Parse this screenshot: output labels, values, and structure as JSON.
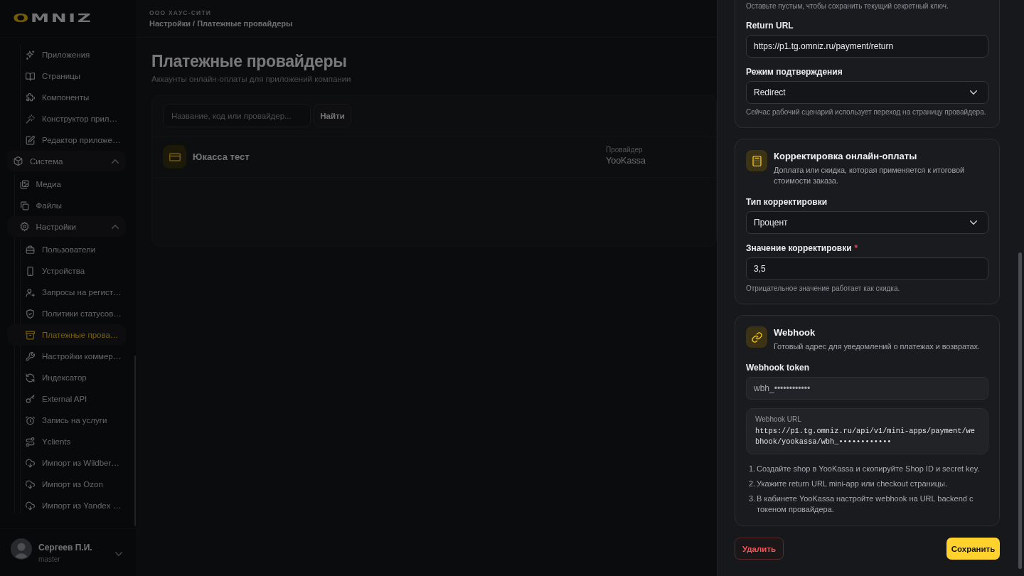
{
  "sidebar": {
    "logo": "OMNIZ",
    "items": [
      {
        "children": [
          {
            "children": [
              {
                "label": "Приложения",
                "selected": false
              },
              {
                "label": "Страницы",
                "selected": false
              },
              {
                "label": "Компоненты",
                "selected": false
              },
              {
                "label": "Конструктор прил…",
                "selected": false
              },
              {
                "label": "Редактор приложе…",
                "selected": false
              }
            ]
          }
        ]
      },
      {
        "label": "Система",
        "expanded": true,
        "children": [
          {
            "label": "Медиа",
            "selected": false
          },
          {
            "label": "Файлы",
            "selected": false
          },
          {
            "label": "Настройки",
            "expanded": true,
            "children": [
              {
                "label": "Пользователи",
                "selected": false
              },
              {
                "label": "Устройства",
                "selected": false
              },
              {
                "label": "Запросы на регист…",
                "selected": false
              },
              {
                "label": "Политики статусов…",
                "selected": false
              },
              {
                "label": "Платежные прова…",
                "selected": true
              },
              {
                "label": "Настройки коммер…",
                "selected": false
              },
              {
                "label": "Индексатор",
                "selected": false
              },
              {
                "label": "External API",
                "selected": false
              },
              {
                "label": "Запись на услуги",
                "selected": false
              },
              {
                "label": "Yclients",
                "selected": false
              },
              {
                "label": "Импорт из Wildber…",
                "selected": false
              },
              {
                "label": "Импорт из Ozon",
                "selected": false
              },
              {
                "label": "Импорт из Yandex …",
                "selected": false
              }
            ]
          }
        ]
      }
    ],
    "user": {
      "name": "Сергеев П.И.",
      "role": "master"
    }
  },
  "header": {
    "company": "ООО ХАУС-СИТИ",
    "breadcrumb": "Настройки / Платежные провайдеры"
  },
  "page": {
    "title": "Платежные провайдеры",
    "subtitle": "Аккаунты онлайн-оплаты для приложений компании",
    "search": {
      "placeholder": "Название, код или провайдер...",
      "button": "Найти"
    },
    "providers": [
      {
        "name": "Юкасса тест",
        "provider_label": "Провайдер",
        "provider": "YooKassa"
      }
    ]
  },
  "drawer": {
    "sections": [
      {
        "leading_hint": "Оставьте пустым, чтобы сохранить текущий секретный ключ.",
        "fields": [
          {
            "kind": "input",
            "label": "Return URL",
            "value": "https://p1.tg.omniz.ru/payment/return",
            "disabled": false
          },
          {
            "kind": "select",
            "label": "Режим подтверждения",
            "value": "Redirect",
            "hint": "Сейчас рабочий сценарий использует переход на страницу провайдера."
          }
        ]
      },
      {
        "title": "Корректировка онлайн-оплаты",
        "description": "Доплата или скидка, которая применяется к итоговой стоимости заказа.",
        "fields": [
          {
            "kind": "select",
            "label": "Тип корректировки",
            "value": "Процент"
          },
          {
            "kind": "input",
            "label": "Значение корректировки",
            "required_mark": "*",
            "value": "3,5",
            "disabled": false,
            "hint": "Отрицательное значение работает как скидка."
          }
        ]
      },
      {
        "title": "Webhook",
        "description": "Готовый адрес для уведомлений о платежах и возвратах.",
        "fields": [
          {
            "kind": "input",
            "label": "Webhook token",
            "value": "wbh_••••••••••••",
            "disabled": true
          },
          {
            "kind": "code",
            "label": "Webhook URL",
            "value": "https://p1.tg.omniz.ru/api/v1/mini-apps/payment/webhook/yookassa/wbh_••••••••••••"
          }
        ],
        "steps": [
          {
            "number": "1.",
            "text": "Создайте shop в YooKassa и скопируйте Shop ID и secret key."
          },
          {
            "number": "2.",
            "text": "Укажите return URL mini-app или checkout страницы."
          },
          {
            "number": "3.",
            "text": "В кабинете YooKassa настройте webhook на URL backend с токеном провайдера."
          }
        ]
      }
    ],
    "actions": {
      "delete": "Удалить",
      "save": "Сохранить"
    }
  }
}
